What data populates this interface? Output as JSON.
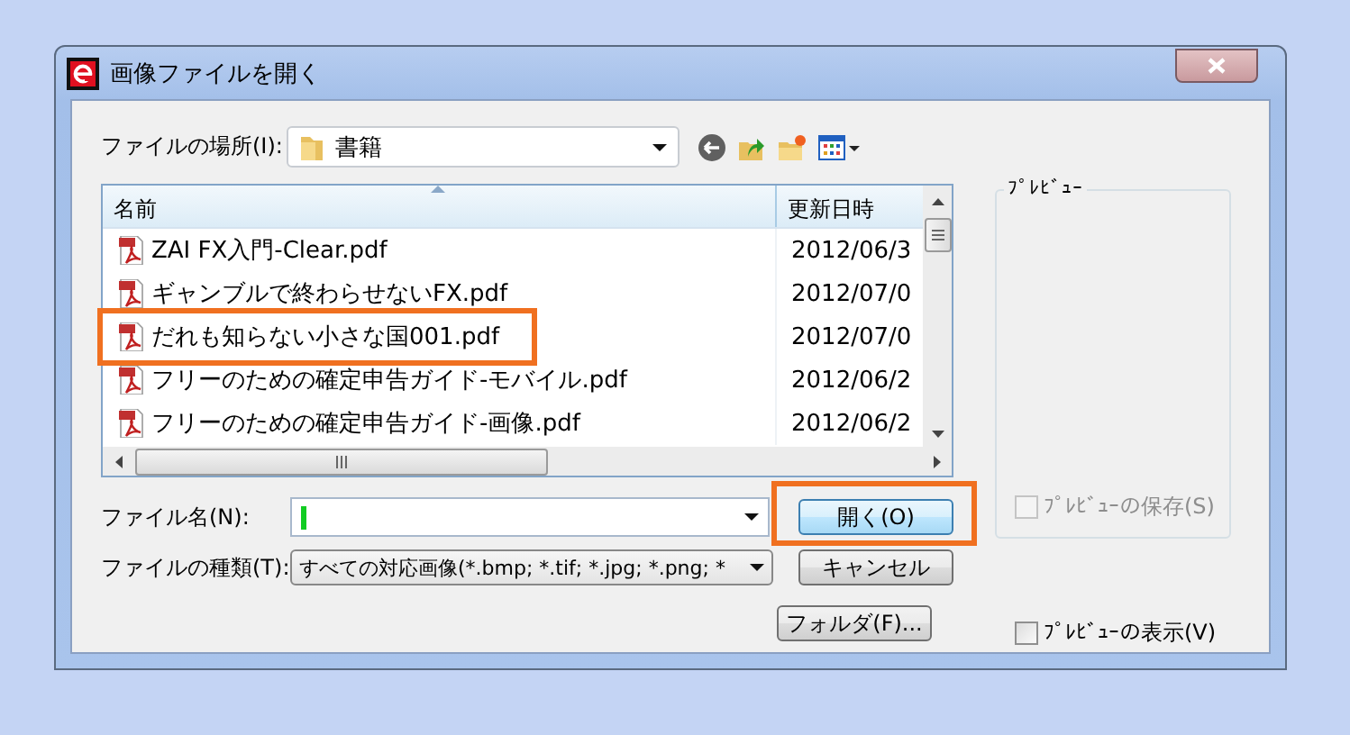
{
  "window": {
    "title": "画像ファイルを開く"
  },
  "location": {
    "label": "ファイルの場所(I):",
    "value": "書籍"
  },
  "file_list": {
    "columns": [
      "名前",
      "更新日時"
    ],
    "rows": [
      {
        "name": "ZAI FX入門-Clear.pdf",
        "date": "2012/06/3",
        "highlighted": false
      },
      {
        "name": "ギャンブルで終わらせないFX.pdf",
        "date": "2012/07/0",
        "highlighted": false
      },
      {
        "name": "だれも知らない小さな国001.pdf",
        "date": "2012/07/0",
        "highlighted": true
      },
      {
        "name": "フリーのための確定申告ガイド-モバイル.pdf",
        "date": "2012/06/2",
        "highlighted": false
      },
      {
        "name": "フリーのための確定申告ガイド-画像.pdf",
        "date": "2012/06/2",
        "highlighted": false
      }
    ]
  },
  "file_name": {
    "label": "ファイル名(N):"
  },
  "file_type": {
    "label": "ファイルの種類(T):",
    "value": "すべての対応画像(*.bmp; *.tif; *.jpg; *.png; *"
  },
  "buttons": [
    {
      "label": "開く(O)",
      "default": true,
      "highlighted": true
    },
    {
      "label": "キャンセル",
      "default": false,
      "highlighted": false
    },
    {
      "label": "フォルダ(F)...",
      "default": false,
      "highlighted": false
    }
  ],
  "preview": {
    "title": "ﾌﾟﾚﾋﾞｭｰ",
    "save": {
      "label": "ﾌﾟﾚﾋﾞｭｰの保存(S)",
      "checked": false,
      "disabled": true
    },
    "show": {
      "label": "ﾌﾟﾚﾋﾞｭｰの表示(V)",
      "checked": false,
      "disabled": false
    }
  }
}
